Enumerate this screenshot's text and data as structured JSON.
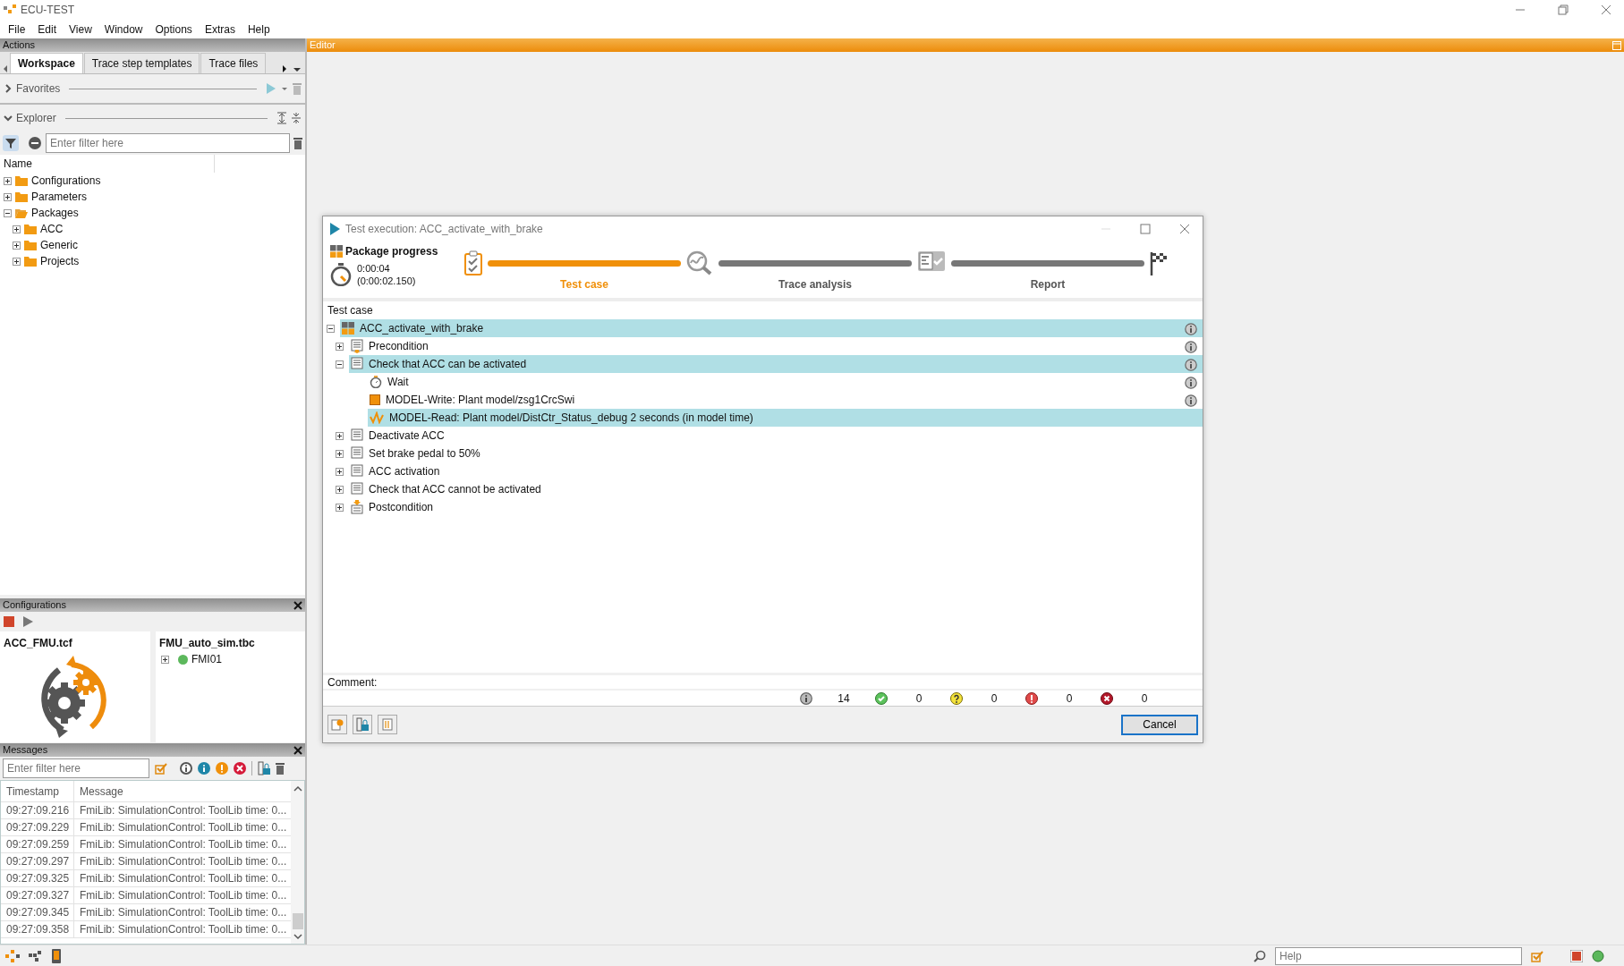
{
  "window": {
    "title": "ECU-TEST"
  },
  "menu": [
    "File",
    "Edit",
    "View",
    "Window",
    "Options",
    "Extras",
    "Help"
  ],
  "actions_panel": {
    "title": "Actions",
    "tabs": [
      {
        "label": "Workspace",
        "selected": true
      },
      {
        "label": "Trace step templates",
        "selected": false
      },
      {
        "label": "Trace files",
        "selected": false
      }
    ],
    "favorites": {
      "label": "Favorites",
      "expanded": false
    },
    "explorer": {
      "label": "Explorer",
      "expanded": true,
      "filter": {
        "placeholder": "Enter filter here"
      },
      "column": "Name",
      "tree": [
        {
          "label": "Configurations",
          "expanded": false
        },
        {
          "label": "Parameters",
          "expanded": false
        },
        {
          "label": "Packages",
          "expanded": true,
          "children": [
            {
              "label": "ACC",
              "expanded": false
            },
            {
              "label": "Generic",
              "expanded": false
            },
            {
              "label": "Projects",
              "expanded": false
            }
          ]
        }
      ]
    }
  },
  "configurations_panel": {
    "title": "Configurations",
    "test_configuration": "ACC_FMU.tcf",
    "test_bench": "FMU_auto_sim.tbc",
    "bench_items": [
      {
        "label": "FMI01",
        "expanded": false,
        "color": "#5cb85c"
      }
    ]
  },
  "messages_panel": {
    "title": "Messages",
    "filter": {
      "placeholder": "Enter filter here"
    },
    "columns": [
      "Timestamp",
      "Message"
    ],
    "rows": [
      {
        "timestamp": "09:27:09.216",
        "message": "FmiLib: SimulationControl: ToolLib time: 0..."
      },
      {
        "timestamp": "09:27:09.229",
        "message": "FmiLib: SimulationControl: ToolLib time: 0..."
      },
      {
        "timestamp": "09:27:09.259",
        "message": "FmiLib: SimulationControl: ToolLib time: 0..."
      },
      {
        "timestamp": "09:27:09.297",
        "message": "FmiLib: SimulationControl: ToolLib time: 0..."
      },
      {
        "timestamp": "09:27:09.325",
        "message": "FmiLib: SimulationControl: ToolLib time: 0..."
      },
      {
        "timestamp": "09:27:09.327",
        "message": "FmiLib: SimulationControl: ToolLib time: 0..."
      },
      {
        "timestamp": "09:27:09.345",
        "message": "FmiLib: SimulationControl: ToolLib time: 0..."
      },
      {
        "timestamp": "09:27:09.358",
        "message": "FmiLib: SimulationControl: ToolLib time: 0..."
      }
    ]
  },
  "editor": {
    "title": "Editor"
  },
  "dialog": {
    "title": "Test execution: ACC_activate_with_brake",
    "package_progress": "Package progress",
    "elapsed": "0:00:04",
    "elapsed_detail": "(0:00:02.150)",
    "stages": [
      {
        "kind": "testcase",
        "label": "Test case",
        "active": true
      },
      {
        "kind": "trace",
        "label": "Trace analysis",
        "active": false
      },
      {
        "kind": "report",
        "label": "Report",
        "active": false
      }
    ],
    "tree_header": "Test case",
    "tree": [
      {
        "label": "ACC_activate_with_brake",
        "kind": "package",
        "expanded": true,
        "selected": true,
        "info": true,
        "children": [
          {
            "label": "Precondition",
            "kind": "precondition",
            "expanded": false,
            "selected": false,
            "info": true
          },
          {
            "label": "Check that ACC can be activated",
            "kind": "block",
            "expanded": true,
            "selected": true,
            "info": true,
            "children": [
              {
                "label": "Wait",
                "kind": "wait",
                "selected": false,
                "info": true
              },
              {
                "label": "MODEL-Write: Plant model/zsg1CrcSwi",
                "kind": "write",
                "selected": false,
                "info": true
              },
              {
                "label": "MODEL-Read: Plant model/DistCtr_Status_debug 2 seconds (in model time)",
                "kind": "read",
                "selected": true,
                "info": false
              }
            ]
          },
          {
            "label": "Deactivate ACC",
            "kind": "block",
            "expanded": false,
            "selected": false,
            "info": false
          },
          {
            "label": "Set brake pedal to 50%",
            "kind": "block",
            "expanded": false,
            "selected": false,
            "info": false
          },
          {
            "label": "ACC activation",
            "kind": "block",
            "expanded": false,
            "selected": false,
            "info": false
          },
          {
            "label": "Check that ACC cannot be activated",
            "kind": "block",
            "expanded": false,
            "selected": false,
            "info": false
          },
          {
            "label": "Postcondition",
            "kind": "postcondition",
            "expanded": false,
            "selected": false,
            "info": false
          }
        ]
      }
    ],
    "comment_label": "Comment:",
    "counters": [
      {
        "kind": "info",
        "count": "14"
      },
      {
        "kind": "success",
        "count": "0"
      },
      {
        "kind": "inconclusive",
        "count": "0"
      },
      {
        "kind": "failed",
        "count": "0"
      },
      {
        "kind": "error",
        "count": "0"
      }
    ],
    "cancel": "Cancel"
  },
  "status_bar": {
    "help": {
      "placeholder": "Help"
    }
  }
}
